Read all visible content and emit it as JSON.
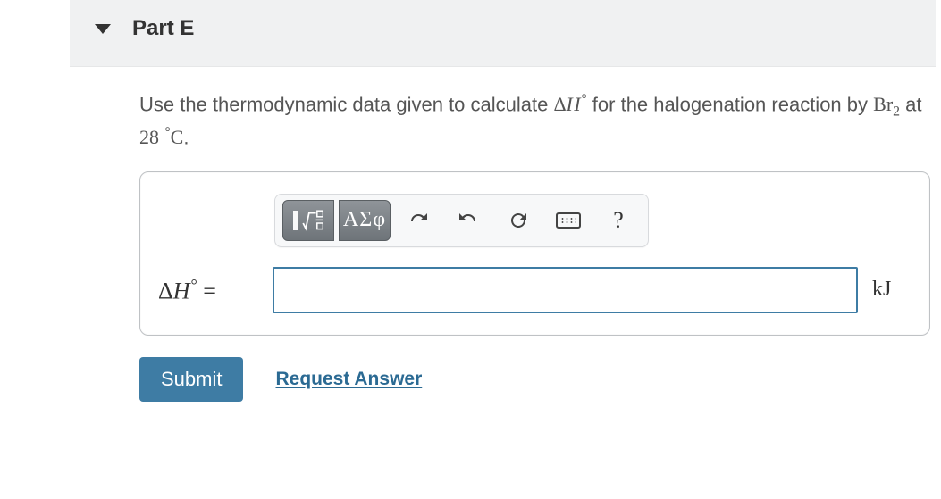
{
  "part": {
    "label": "Part E"
  },
  "prompt": {
    "lead": "Use the thermodynamic data given to calculate ",
    "deltaH_symbol_prefix": "Δ",
    "deltaH_symbol_var": "H",
    "deltaH_symbol_degree": "°",
    "mid": " for the halogenation reaction by ",
    "reagent_base": "Br",
    "reagent_sub": "2",
    "at_word": " at ",
    "temp_value": "28",
    "temp_unit_degree": "°",
    "temp_unit": "C",
    "tail": "."
  },
  "toolbar": {
    "templates_name": "math-templates-button",
    "greek_label": "ΑΣφ",
    "undo_name": "undo-button",
    "redo_name": "redo-button",
    "reset_name": "reset-button",
    "keyboard_name": "keyboard-button",
    "help_label": "?"
  },
  "input": {
    "var_delta": "Δ",
    "var_H": "H",
    "var_degree": "°",
    "equals": " = ",
    "value": "",
    "unit": "kJ"
  },
  "actions": {
    "submit": "Submit",
    "request": "Request Answer"
  }
}
